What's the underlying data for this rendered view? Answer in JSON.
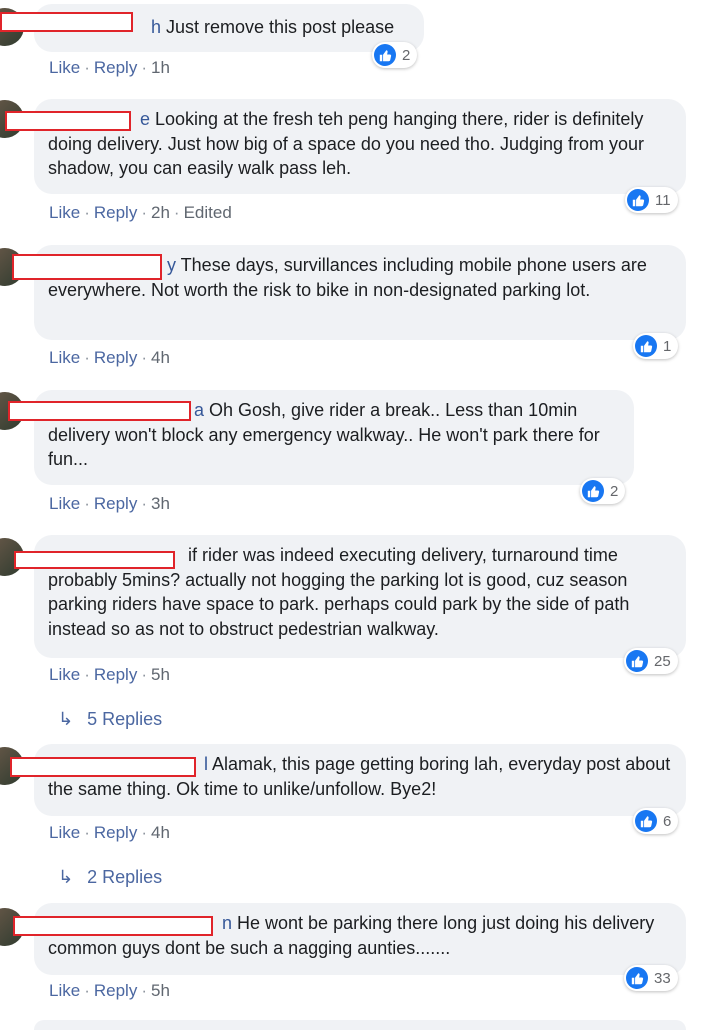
{
  "comments": [
    {
      "author_suffix": "h",
      "text": " Just remove this post please",
      "like": "Like",
      "reply": "Reply",
      "time": "1h",
      "edited": "",
      "reactions": "2"
    },
    {
      "author_suffix": "e",
      "text": " Looking at the fresh teh peng hanging there, rider is definitely doing delivery. Just how big of a space do you need tho. Judging from your shadow, you can easily walk pass leh.",
      "like": "Like",
      "reply": "Reply",
      "time": "2h",
      "edited": "Edited",
      "reactions": "11"
    },
    {
      "author_suffix": "y",
      "text": " These days, survillances including mobile phone users are everywhere. Not worth the risk to bike in non-designated parking lot.",
      "like": "Like",
      "reply": "Reply",
      "time": "4h",
      "edited": "",
      "reactions": "1"
    },
    {
      "author_suffix": "a",
      "text": " Oh Gosh, give rider a break.. Less than 10min delivery won't block any emergency walkway.. He won't park there for fun...",
      "like": "Like",
      "reply": "Reply",
      "time": "3h",
      "edited": "",
      "reactions": "2"
    },
    {
      "author_suffix": "",
      "text": " if rider was indeed executing delivery, turnaround time probably 5mins? actually not hogging the parking lot is good, cuz season parking riders have space to park. perhaps could park by the side of path instead so as not to obstruct pedestrian walkway.",
      "like": "Like",
      "reply": "Reply",
      "time": "5h",
      "edited": "",
      "reactions": "25",
      "replies": "5 Replies"
    },
    {
      "author_suffix": "l",
      "text": " Alamak, this page getting boring lah, everyday post about the same thing. Ok time to unlike/unfollow. Bye2!",
      "like": "Like",
      "reply": "Reply",
      "time": "4h",
      "edited": "",
      "reactions": "6",
      "replies": "2 Replies"
    },
    {
      "author_suffix": "n",
      "text": " He wont be parking there long just doing his delivery common guys dont be such a nagging aunties.......",
      "like": "Like",
      "reply": "Reply",
      "time": "5h",
      "edited": "",
      "reactions": "33"
    }
  ],
  "colors": {
    "link": "#4b67a1",
    "bubble": "#f0f2f5",
    "like_blue": "#1877f2",
    "redaction": "#e0242a"
  },
  "icons": {
    "reaction": "thumbs-up-icon",
    "reply_arrow": "reply-arrow-icon"
  }
}
